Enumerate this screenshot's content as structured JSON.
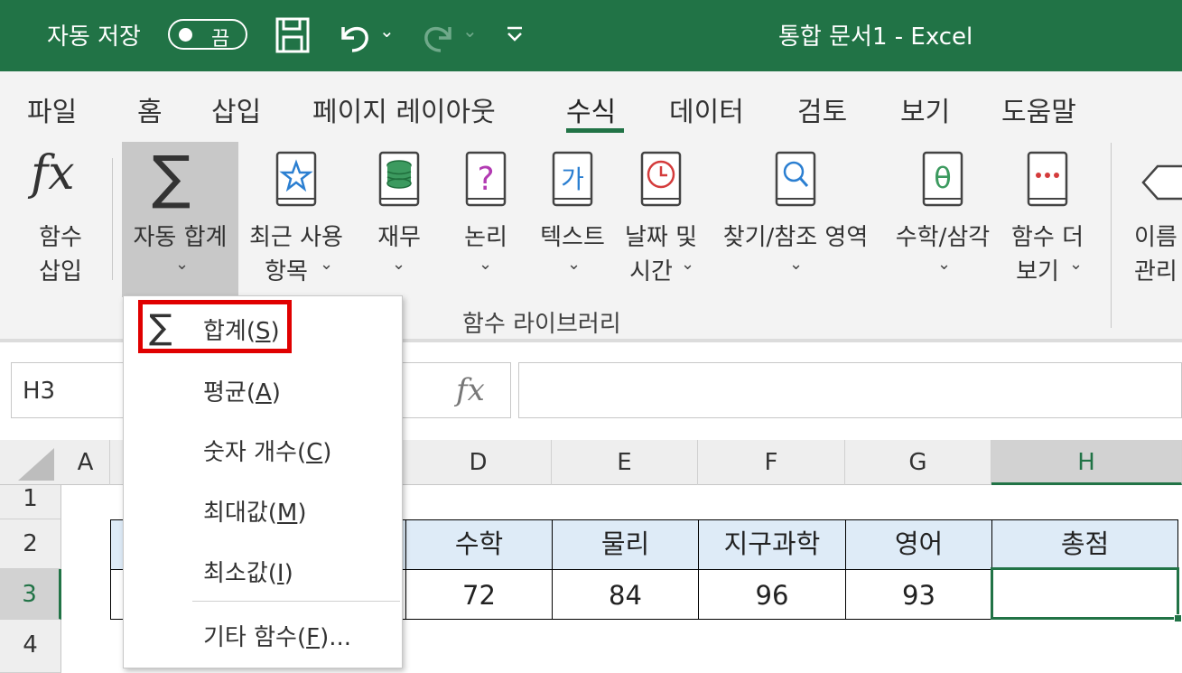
{
  "title_bar": {
    "autosave_label": "자동 저장",
    "autosave_toggle": "끔",
    "window_title": "통합 문서1  -  Excel"
  },
  "ribbon_tabs": [
    "파일",
    "홈",
    "삽입",
    "페이지 레이아웃",
    "수식",
    "데이터",
    "검토",
    "보기",
    "도움말"
  ],
  "active_tab": "수식",
  "ribbon": {
    "insert_function": [
      "함수",
      "삽입"
    ],
    "autosum": "자동 합계",
    "recent": [
      "최근 사용",
      "항목"
    ],
    "financial": "재무",
    "logical": "논리",
    "text": "텍스트",
    "datetime": [
      "날짜 및",
      "시간"
    ],
    "lookup": "찾기/참조 영역",
    "math": "수학/삼각",
    "more": [
      "함수 더",
      "보기"
    ],
    "names": [
      "이름",
      "관리"
    ],
    "group_label": "함수 라이브러리",
    "text_icon_glyph": "가"
  },
  "formula_bar": {
    "name_box": "H3",
    "fx": "fx",
    "value": ""
  },
  "autosum_menu": {
    "items": [
      {
        "label": "합계(",
        "key": "S",
        "suffix": ")"
      },
      {
        "label": "평균(",
        "key": "A",
        "suffix": ")"
      },
      {
        "label": "숫자 개수(",
        "key": "C",
        "suffix": ")"
      },
      {
        "label": "최대값(",
        "key": "M",
        "suffix": ")"
      },
      {
        "label": "최소값(",
        "key": "I",
        "suffix": ")"
      },
      {
        "label": "기타 함수(",
        "key": "F",
        "suffix": ")..."
      }
    ]
  },
  "grid": {
    "columns": [
      "A",
      "D",
      "E",
      "F",
      "G",
      "H"
    ],
    "rows": [
      "1",
      "2",
      "3",
      "4"
    ],
    "selected_cell": "H3",
    "headers": [
      "수학",
      "물리",
      "지구과학",
      "영어",
      "총점"
    ],
    "values": [
      "72",
      "84",
      "96",
      "93",
      ""
    ]
  },
  "colors": {
    "accent": "#217346",
    "header_fill": "#deebf7",
    "highlight": "#e00000"
  }
}
